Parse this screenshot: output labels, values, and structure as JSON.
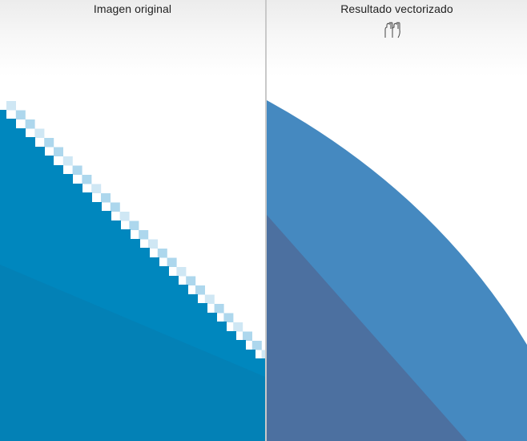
{
  "left_panel": {
    "title": "Imagen original"
  },
  "right_panel": {
    "title": "Resultado vectorizado"
  },
  "colors": {
    "pixel_fill": "#0087be",
    "pixel_fill_dark": "#0a75a8",
    "pixel_edge_light": "#9fd0ea",
    "vector_light": "#4589c0",
    "vector_dark": "#4c70a0",
    "divider": "#c9c9c9"
  },
  "icons": {
    "cursor": "hand-grab-icon"
  }
}
